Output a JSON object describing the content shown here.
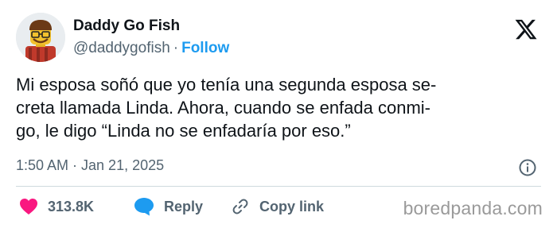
{
  "author": {
    "name": "Daddy Go Fish",
    "handle": "@daddygofish",
    "separator": "·",
    "follow_label": "Follow"
  },
  "tweet": {
    "text": "Mi esposa soñó que yo tenía una segunda esposa se-\ncreta llamada Linda. Ahora, cuando se enfada conmi-\ngo, le digo “Linda no se enfadaría por eso.”",
    "timestamp": "1:50 AM · Jan 21, 2025"
  },
  "actions": {
    "likes": "313.8K",
    "reply_label": "Reply",
    "copy_label": "Copy link"
  },
  "watermark": "boredpanda.com",
  "colors": {
    "accent": "#1d9bf0",
    "like": "#f91880",
    "muted": "#536471",
    "text": "#0f1419"
  },
  "icons": [
    "x-logo-icon",
    "info-icon",
    "heart-icon",
    "reply-bubble-icon",
    "link-icon"
  ]
}
